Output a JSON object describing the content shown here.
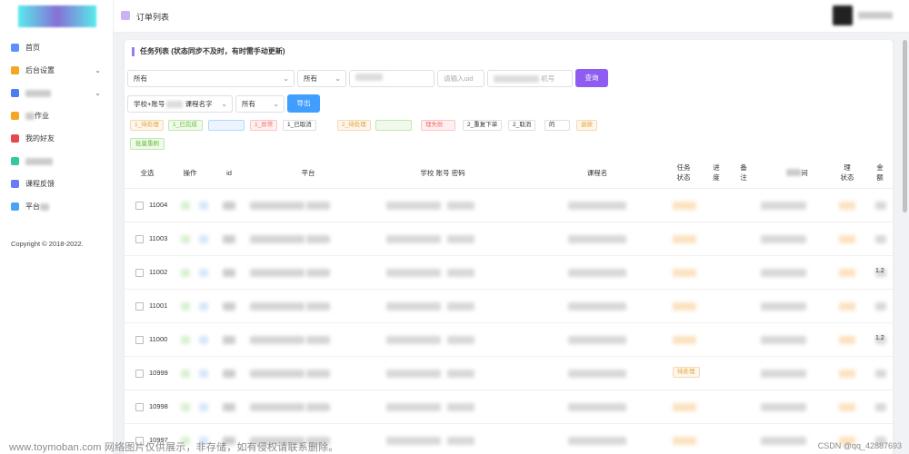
{
  "header": {
    "breadcrumb": "订单列表"
  },
  "sidebar": {
    "items": [
      {
        "label": "首页",
        "color": "#5b8ff9",
        "has_arrow": false
      },
      {
        "label": "后台设置",
        "color": "#f5a623",
        "has_arrow": true
      },
      {
        "label": "",
        "color": "#4a7cf5",
        "has_arrow": true
      },
      {
        "label": "作业",
        "color": "#f5a623",
        "has_arrow": false
      },
      {
        "label": "我的好友",
        "color": "#e8484b",
        "has_arrow": false
      },
      {
        "label": "",
        "color": "#36c6a0",
        "has_arrow": false
      },
      {
        "label": "课程反馈",
        "color": "#6a7cf5",
        "has_arrow": false
      },
      {
        "label": "平台",
        "color": "#4aa3f5",
        "has_arrow": false
      }
    ],
    "copyright": "Copyright © 2018-2022."
  },
  "main": {
    "title": "任务列表 (状态同步不及时，有时需手动更新)",
    "filters": {
      "select1": "所有",
      "select2": "所有",
      "uid_placeholder": "请输入uid",
      "phone_placeholder": "机号",
      "query_label": "查询",
      "select3": "学校+账号",
      "select3_tail": "课程名字",
      "select4": "所有",
      "export_label": "导出"
    },
    "tags": [
      {
        "label": "1_待处理",
        "color": "#e6a23c",
        "bg": "#fdf6ec",
        "border": "#f5dab1"
      },
      {
        "label": "1_已完成",
        "color": "#67c23a",
        "bg": "#f0f9eb",
        "border": "#c2e7b0"
      },
      {
        "label": "",
        "color": "#409eff",
        "bg": "#ecf5ff",
        "border": "#b3d8ff"
      },
      {
        "label": "1_异常",
        "color": "#f56c6c",
        "bg": "#fef0f0",
        "border": "#fbc4c4"
      },
      {
        "label": "1_已取消",
        "color": "#333333",
        "bg": "#ffffff",
        "border": "#dcdfe6"
      },
      {
        "label": "2_待处理",
        "color": "#e6a23c",
        "bg": "#fdf6ec",
        "border": "#f5dab1"
      },
      {
        "label": "",
        "color": "#67c23a",
        "bg": "#f0f9eb",
        "border": "#c2e7b0"
      },
      {
        "label": "理失败",
        "color": "#f56c6c",
        "bg": "#fef0f0",
        "border": "#fbc4c4"
      },
      {
        "label": "2_重复下单",
        "color": "#333333",
        "bg": "#ffffff",
        "border": "#dcdfe6"
      },
      {
        "label": "2_取消",
        "color": "#333333",
        "bg": "#ffffff",
        "border": "#dcdfe6"
      },
      {
        "label": "的",
        "color": "#333333",
        "bg": "#ffffff",
        "border": "#dcdfe6"
      },
      {
        "label": "退款",
        "color": "#e6a23c",
        "bg": "#fdf6ec",
        "border": "#f5dab1"
      }
    ],
    "batch_label": "批量重刷",
    "table": {
      "headers": {
        "select_all": "全选",
        "ops": "操作",
        "uid": "id",
        "platform": "平台",
        "school_account": "学校 账号 密码",
        "course": "课程名",
        "task_status": "任务\n状态",
        "progress": "进\n度",
        "remark": "备\n注",
        "time": "间",
        "proc_status": "理\n状态",
        "amount": "金\n额"
      },
      "rows": [
        {
          "id": "11004",
          "badge": "",
          "amount": ""
        },
        {
          "id": "11003",
          "badge": "",
          "amount": ""
        },
        {
          "id": "11002",
          "badge": "",
          "amount": "1.2"
        },
        {
          "id": "11001",
          "badge": "",
          "amount": ""
        },
        {
          "id": "11000",
          "badge": "",
          "amount": "1.2"
        },
        {
          "id": "10999",
          "badge": "待处理",
          "amount": ""
        },
        {
          "id": "10998",
          "badge": "",
          "amount": ""
        },
        {
          "id": "10997",
          "badge": "",
          "amount": ""
        }
      ]
    }
  },
  "watermark": "www.toymoban.com 网络图片仅供展示，非存储，如有侵权请联系删除。",
  "watermark_right": "CSDN @qq_42887693"
}
